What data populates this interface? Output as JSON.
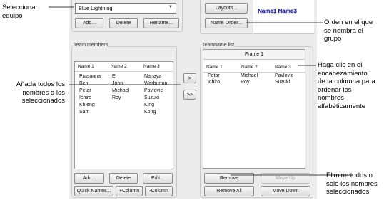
{
  "combo": {
    "value": "Blue Lightning"
  },
  "top_left_buttons": {
    "add": "Add...",
    "delete": "Delete",
    "rename": "Rename..."
  },
  "top_right_buttons": {
    "layouts": "Layouts...",
    "name_order": "Name Order..."
  },
  "preview_text": "Name1 Name3",
  "team_members": {
    "title": "Team members",
    "headers": [
      "Name 1",
      "Name 2",
      "Name 3"
    ],
    "rows": [
      [
        "Prasanna",
        "E",
        "Nanaya"
      ],
      [
        "Ben",
        "John",
        "Warburton"
      ],
      [
        "Petar",
        "Michael",
        "Pavlovic"
      ],
      [
        "Ichiro",
        "Roy",
        "Suzuki"
      ],
      [
        "Khieng",
        "",
        "King"
      ],
      [
        "Sam",
        "",
        "Kong"
      ]
    ]
  },
  "move": {
    "one": ">",
    "all": ">>"
  },
  "teamname_list": {
    "title": "Teamname list",
    "frame_label": "Frame 1",
    "headers": [
      "Name 1",
      "Name 2",
      "Name 3"
    ],
    "rows": [
      [
        "Petar",
        "Michael",
        "Pavlovic"
      ],
      [
        "Ichiro",
        "Roy",
        "Suzuki"
      ]
    ]
  },
  "bottom_left_buttons": {
    "add": "Add...",
    "delete": "Delete",
    "edit": "Edit...",
    "quick_names": "Quick Names...",
    "add_column": "+Column",
    "remove_column": "-Column"
  },
  "bottom_right_buttons": {
    "remove": "Remove",
    "move_up": "Move Up",
    "remove_all": "Remove All",
    "move_down": "Move Down"
  },
  "annotations": {
    "select_team": "Seleccionar\nequipo",
    "order": "Orden en el que\nse nombra el\ngrupo",
    "add_names": "Añada todos los\nnombres o los\nseleccionados",
    "sort": "Haga clic en el\nencabezamiento\nde la columna para\nordenar los\nnombres\nalfabéticamente",
    "remove": "Elimine todos o\nsolo los nombres\nseleccionados"
  },
  "colors": {
    "preview_text": "#1a1a8c",
    "dialog_bg": "#ececec",
    "accent": "#000000"
  }
}
